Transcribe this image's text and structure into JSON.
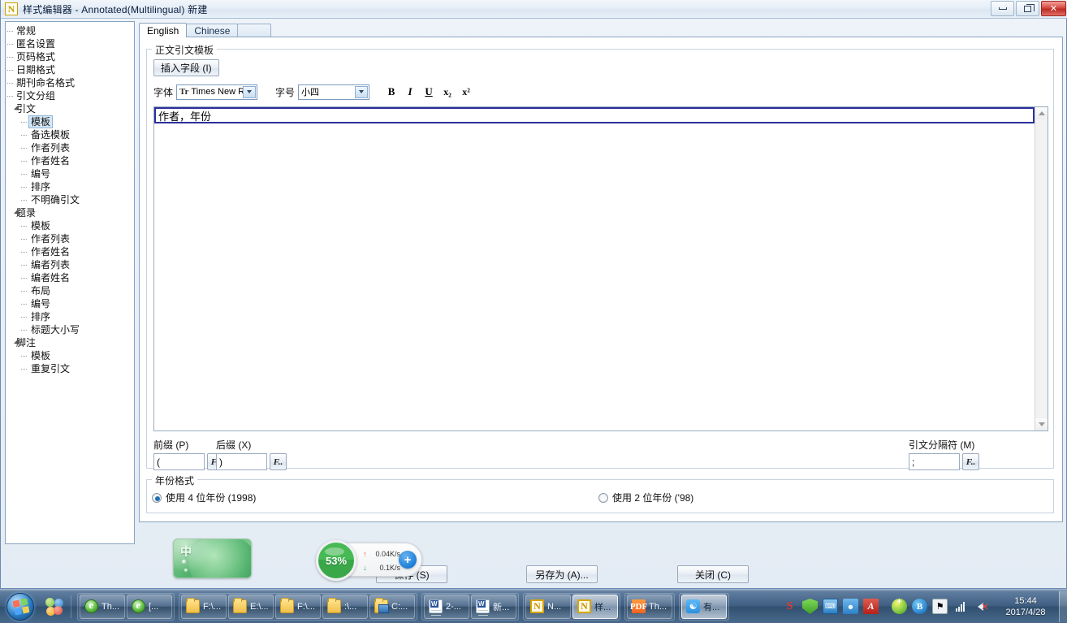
{
  "window": {
    "title": "样式编辑器 - Annotated(Multilingual) 新建",
    "app_icon": "N",
    "minimize_label": "最小化",
    "restore_label": "还原",
    "close_label": "关闭"
  },
  "tree": [
    {
      "label": "常规",
      "level": 0,
      "expander": "none",
      "selected": false
    },
    {
      "label": "匿名设置",
      "level": 0,
      "expander": "none",
      "selected": false
    },
    {
      "label": "页码格式",
      "level": 0,
      "expander": "none",
      "selected": false
    },
    {
      "label": "日期格式",
      "level": 0,
      "expander": "none",
      "selected": false
    },
    {
      "label": "期刊命名格式",
      "level": 0,
      "expander": "none",
      "selected": false
    },
    {
      "label": "引文分组",
      "level": 0,
      "expander": "none",
      "selected": false
    },
    {
      "label": "引文",
      "level": 0,
      "expander": "expanded",
      "selected": false
    },
    {
      "label": "模板",
      "level": 1,
      "expander": "none",
      "selected": true
    },
    {
      "label": "备选模板",
      "level": 1,
      "expander": "none",
      "selected": false
    },
    {
      "label": "作者列表",
      "level": 1,
      "expander": "none",
      "selected": false
    },
    {
      "label": "作者姓名",
      "level": 1,
      "expander": "none",
      "selected": false
    },
    {
      "label": "编号",
      "level": 1,
      "expander": "none",
      "selected": false
    },
    {
      "label": "排序",
      "level": 1,
      "expander": "none",
      "selected": false
    },
    {
      "label": "不明确引文",
      "level": 1,
      "expander": "none",
      "selected": false
    },
    {
      "label": "题录",
      "level": 0,
      "expander": "expanded",
      "selected": false
    },
    {
      "label": "模板",
      "level": 1,
      "expander": "none",
      "selected": false
    },
    {
      "label": "作者列表",
      "level": 1,
      "expander": "none",
      "selected": false
    },
    {
      "label": "作者姓名",
      "level": 1,
      "expander": "none",
      "selected": false
    },
    {
      "label": "编者列表",
      "level": 1,
      "expander": "none",
      "selected": false
    },
    {
      "label": "编者姓名",
      "level": 1,
      "expander": "none",
      "selected": false
    },
    {
      "label": "布局",
      "level": 1,
      "expander": "none",
      "selected": false
    },
    {
      "label": "编号",
      "level": 1,
      "expander": "none",
      "selected": false
    },
    {
      "label": "排序",
      "level": 1,
      "expander": "none",
      "selected": false
    },
    {
      "label": "标题大小写",
      "level": 1,
      "expander": "none",
      "selected": false
    },
    {
      "label": "脚注",
      "level": 0,
      "expander": "expanded",
      "selected": false
    },
    {
      "label": "模板",
      "level": 1,
      "expander": "none",
      "selected": false
    },
    {
      "label": "重复引文",
      "level": 1,
      "expander": "none",
      "selected": false
    }
  ],
  "tabs": [
    {
      "label": "English",
      "active": true
    },
    {
      "label": "Chinese",
      "active": false
    },
    {
      "label": "",
      "active": false
    }
  ],
  "template_group": {
    "legend": "正文引文模板",
    "insert_field_button": "插入字段 (I)",
    "font_label": "字体",
    "font_value": "Times New R",
    "font_icon": "Tr",
    "size_label": "字号",
    "size_value": "小四",
    "format_buttons": [
      {
        "name": "bold-button",
        "glyph": "B"
      },
      {
        "name": "italic-button",
        "glyph": "I"
      },
      {
        "name": "underline-button",
        "glyph": "U"
      },
      {
        "name": "subscript-button",
        "glyph": "x₂"
      },
      {
        "name": "superscript-button",
        "glyph": "x²"
      }
    ],
    "editor_text": "作者，年份",
    "prefix_label": "前缀 (P)",
    "prefix_value": "(",
    "suffix_label": "后缀 (X)",
    "suffix_value": ")",
    "separator_label": "引文分隔符 (M)",
    "separator_value": ";",
    "field_picker_button": "F.."
  },
  "year_group": {
    "legend": "年份格式",
    "option_four": "使用 4 位年份 (1998)",
    "option_two": "使用 2 位年份 ('98)",
    "selected": "four"
  },
  "footer_buttons": {
    "save": "保存 (S)",
    "save_as": "另存为 (A)...",
    "close": "关闭 (C)"
  },
  "ime": {
    "mode": "中"
  },
  "network_widget": {
    "percent": "53%",
    "upload": "0.04K/s",
    "download": "0.1K/s",
    "up_arrow": "↑",
    "down_arrow": "↓",
    "add_button": "+"
  },
  "taskbar": {
    "start_label": "开始",
    "quick_launch": [
      {
        "name": "quick-launch-ie-icon",
        "icon": "ie"
      },
      {
        "name": "quick-launch-switcher-icon",
        "icon": "switcher"
      }
    ],
    "groups": [
      {
        "items": [
          {
            "label": "Th...",
            "icon": "ie",
            "active": false
          },
          {
            "label": "[...",
            "icon": "ie",
            "active": false
          }
        ]
      },
      {
        "items": [
          {
            "label": "F:\\...",
            "icon": "folder",
            "active": false
          },
          {
            "label": "E:\\...",
            "icon": "folder",
            "active": false
          },
          {
            "label": "F:\\...",
            "icon": "folder",
            "active": false
          },
          {
            "label": ":\\...",
            "icon": "folder",
            "active": false
          },
          {
            "label": "C:...",
            "icon": "folder-blue",
            "active": false
          }
        ]
      },
      {
        "items": [
          {
            "label": "2-...",
            "icon": "word",
            "active": false
          },
          {
            "label": "新...",
            "icon": "word",
            "active": false
          }
        ]
      },
      {
        "items": [
          {
            "label": "N...",
            "icon": "note",
            "active": false
          },
          {
            "label": "样...",
            "icon": "note",
            "active": true
          }
        ]
      },
      {
        "items": [
          {
            "label": "Th...",
            "icon": "pdf",
            "active": false
          }
        ]
      },
      {
        "items": [
          {
            "label": "有...",
            "icon": "youdao",
            "active": true
          }
        ]
      }
    ],
    "tray": [
      {
        "name": "sogou-input-icon",
        "glyph": "S"
      },
      {
        "name": "security-shield-icon",
        "glyph": ""
      },
      {
        "name": "network-manager-icon",
        "glyph": ""
      },
      {
        "name": "contact-icon",
        "glyph": ""
      },
      {
        "name": "acrobat-icon",
        "glyph": "A"
      },
      {
        "name": "update-icon",
        "glyph": ""
      },
      {
        "name": "bluetooth-icon",
        "glyph": "B"
      },
      {
        "name": "action-center-icon",
        "glyph": ""
      },
      {
        "name": "network-signal-icon",
        "glyph": ""
      },
      {
        "name": "volume-muted-icon",
        "glyph": ""
      }
    ],
    "clock": {
      "time": "15:44",
      "date": "2017/4/28"
    }
  }
}
